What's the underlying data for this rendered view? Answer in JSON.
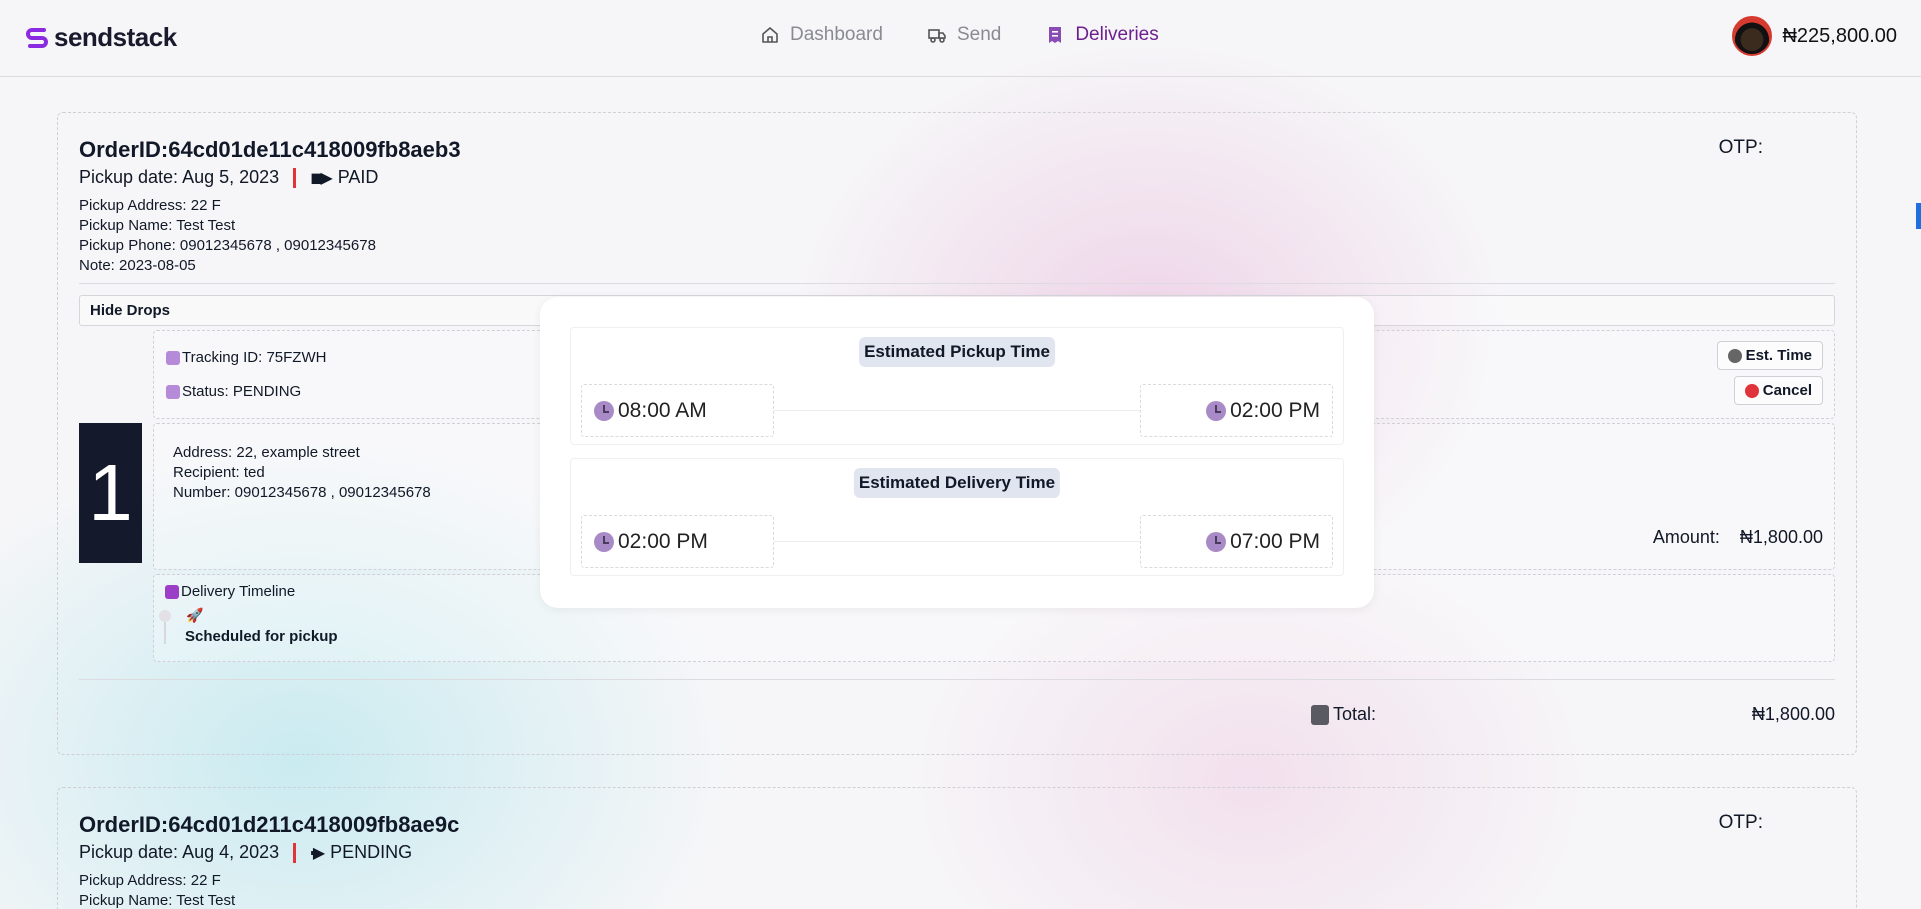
{
  "header": {
    "logo_text": "sendstack",
    "nav": [
      {
        "label": "Dashboard",
        "icon": "home-icon",
        "active": false
      },
      {
        "label": "Send",
        "icon": "truck-icon",
        "active": false
      },
      {
        "label": "Deliveries",
        "icon": "receipt-icon",
        "active": true
      }
    ],
    "balance": "₦225,800.00"
  },
  "orders": [
    {
      "order_id": "OrderID:64cd01de11c418009fb8aeb3",
      "pickup_date": "Pickup date: Aug 5, 2023",
      "payment_status": "PAID",
      "otp_label": "OTP:",
      "pickup_address": "Pickup Address: 22 F",
      "pickup_name": "Pickup Name: Test Test",
      "pickup_phone": "Pickup Phone: 09012345678 , 09012345678",
      "note": "Note: 2023-08-05",
      "hide_drops_label": "Hide Drops",
      "drop": {
        "number": "1",
        "tracking_id": "Tracking ID: 75FZWH",
        "status": "Status: PENDING",
        "est_time_button": "Est. Time",
        "cancel_button": "Cancel",
        "address": "Address: 22, example street",
        "recipient": "Recipient: ted",
        "number_line": "Number: 09012345678 , 09012345678",
        "amount_label": "Amount:",
        "amount_value": "₦1,800.00",
        "timeline_title": "Delivery Timeline",
        "timeline_event": "Scheduled for pickup"
      },
      "total_label": "Total:",
      "total_value": "₦1,800.00"
    },
    {
      "order_id": "OrderID:64cd01d211c418009fb8ae9c",
      "pickup_date": "Pickup date: Aug 4, 2023",
      "payment_status": "PENDING",
      "otp_label": "OTP:",
      "pickup_address": "Pickup Address: 22 F",
      "pickup_name": "Pickup Name: Test Test"
    }
  ],
  "modal": {
    "pickup_title": "Estimated Pickup Time",
    "pickup_start": "08:00 AM",
    "pickup_end": "02:00 PM",
    "delivery_title": "Estimated Delivery Time",
    "delivery_start": "02:00 PM",
    "delivery_end": "07:00 PM"
  }
}
